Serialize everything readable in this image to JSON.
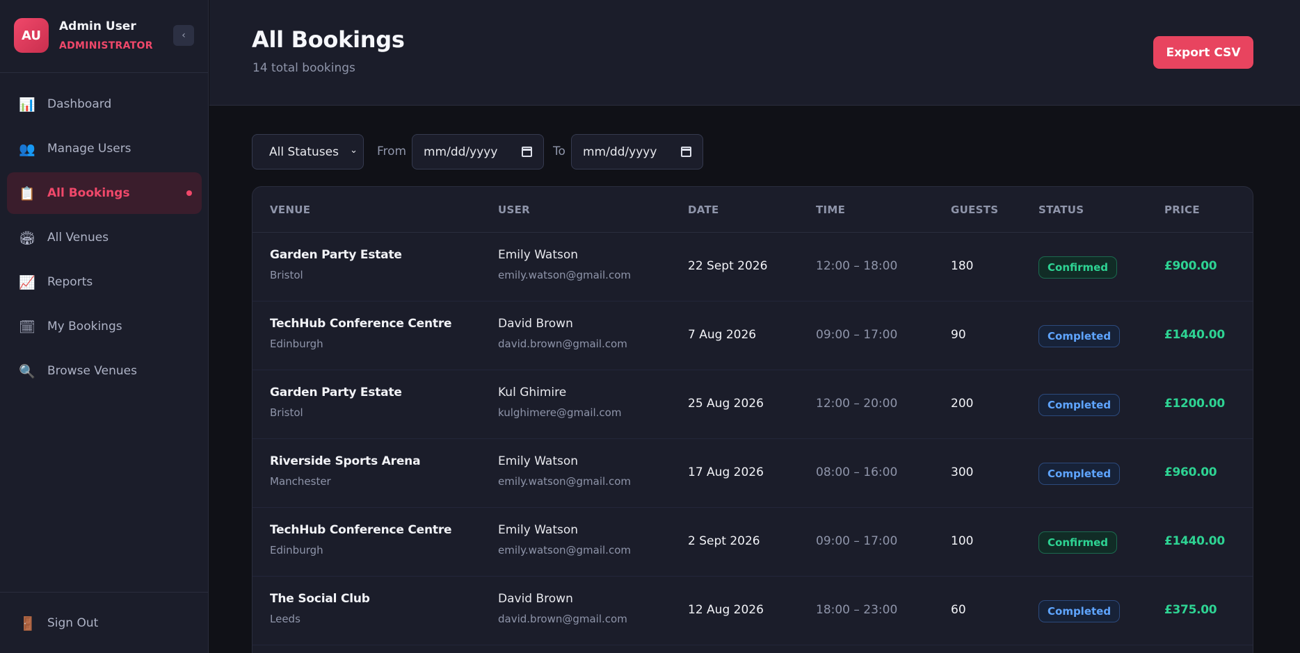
{
  "sidebar": {
    "avatar_initials": "AU",
    "user_name": "Admin User",
    "user_role": "ADMINISTRATOR",
    "collapse_glyph": "‹",
    "items": [
      {
        "label": "Dashboard",
        "icon": "chart-icon",
        "glyph": "📊",
        "active": false
      },
      {
        "label": "Manage Users",
        "icon": "users-icon",
        "glyph": "👥",
        "active": false
      },
      {
        "label": "All Bookings",
        "icon": "clipboard-icon",
        "glyph": "📋",
        "active": true
      },
      {
        "label": "All Venues",
        "icon": "stadium-icon",
        "glyph": "🏟",
        "active": false
      },
      {
        "label": "Reports",
        "icon": "trend-chart-icon",
        "glyph": "📈",
        "active": false
      },
      {
        "label": "My Bookings",
        "icon": "calendar-icon",
        "glyph": "🗓",
        "active": false
      },
      {
        "label": "Browse Venues",
        "icon": "magnifier-icon",
        "glyph": "🔍",
        "active": false
      }
    ],
    "sign_out": {
      "label": "Sign Out",
      "icon": "door-icon",
      "glyph": "🚪"
    }
  },
  "header": {
    "title": "All Bookings",
    "subtitle": "14 total bookings",
    "export_label": "Export CSV"
  },
  "filters": {
    "status_value": "All Statuses",
    "from_label": "From",
    "from_placeholder": "mm/dd/yyyy",
    "to_label": "To",
    "to_placeholder": "mm/dd/yyyy"
  },
  "table": {
    "columns": [
      "VENUE",
      "USER",
      "DATE",
      "TIME",
      "GUESTS",
      "STATUS",
      "PRICE"
    ],
    "rows": [
      {
        "venue": "Garden Party Estate",
        "city": "Bristol",
        "user": "Emily Watson",
        "email": "emily.watson@gmail.com",
        "date": "22 Sept 2026",
        "time": "12:00 – 18:00",
        "guests": "180",
        "status": "Confirmed",
        "price": "£900.00"
      },
      {
        "venue": "TechHub Conference Centre",
        "city": "Edinburgh",
        "user": "David Brown",
        "email": "david.brown@gmail.com",
        "date": "7 Aug 2026",
        "time": "09:00 – 17:00",
        "guests": "90",
        "status": "Completed",
        "price": "£1440.00"
      },
      {
        "venue": "Garden Party Estate",
        "city": "Bristol",
        "user": "Kul Ghimire",
        "email": "kulghimere@gmail.com",
        "date": "25 Aug 2026",
        "time": "12:00 – 20:00",
        "guests": "200",
        "status": "Completed",
        "price": "£1200.00"
      },
      {
        "venue": "Riverside Sports Arena",
        "city": "Manchester",
        "user": "Emily Watson",
        "email": "emily.watson@gmail.com",
        "date": "17 Aug 2026",
        "time": "08:00 – 16:00",
        "guests": "300",
        "status": "Completed",
        "price": "£960.00"
      },
      {
        "venue": "TechHub Conference Centre",
        "city": "Edinburgh",
        "user": "Emily Watson",
        "email": "emily.watson@gmail.com",
        "date": "2 Sept 2026",
        "time": "09:00 – 17:00",
        "guests": "100",
        "status": "Confirmed",
        "price": "£1440.00"
      },
      {
        "venue": "The Social Club",
        "city": "Leeds",
        "user": "David Brown",
        "email": "david.brown@gmail.com",
        "date": "12 Aug 2026",
        "time": "18:00 – 23:00",
        "guests": "60",
        "status": "Completed",
        "price": "£375.00"
      }
    ]
  },
  "colors": {
    "accent": "#e8445f",
    "confirmed": "#2ed393",
    "completed": "#5fa5ff",
    "price": "#2ed393"
  }
}
